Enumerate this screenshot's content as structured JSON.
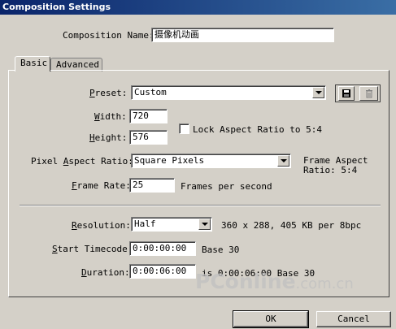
{
  "window": {
    "title": "Composition Settings"
  },
  "composition_name": {
    "label": "Composition Name:",
    "value": "摄像机动画"
  },
  "tabs": [
    {
      "label": "Basic",
      "active": true
    },
    {
      "label": "Advanced",
      "active": false
    }
  ],
  "preset": {
    "label": "Preset:",
    "value": "Custom",
    "save_icon": "save-icon",
    "delete_icon": "trash-icon"
  },
  "width": {
    "label": "Width:",
    "value": "720"
  },
  "height": {
    "label": "Height:",
    "value": "576"
  },
  "lock_aspect": {
    "label": "Lock Aspect Ratio to 5:4",
    "checked": false
  },
  "pixel_aspect": {
    "label": "Pixel Aspect Ratio:",
    "value": "Square Pixels",
    "frame_aspect_line1": "Frame Aspect",
    "frame_aspect_line2": "Ratio: 5:4"
  },
  "frame_rate": {
    "label": "Frame Rate:",
    "value": "25",
    "unit": "Frames per second"
  },
  "resolution": {
    "label": "Resolution:",
    "value": "Half",
    "info": "360 x 288, 405 KB per 8bpc"
  },
  "start_timecode": {
    "label": "Start Timecode:",
    "value": "0:00:00:00",
    "base": "Base 30"
  },
  "duration": {
    "label": "Duration:",
    "value": "0:00:06:00",
    "info": "is 0:00:06:00  Base 30"
  },
  "buttons": {
    "ok": "OK",
    "cancel": "Cancel"
  },
  "watermark": {
    "main": "PConline",
    "sub": ".com.cn"
  }
}
